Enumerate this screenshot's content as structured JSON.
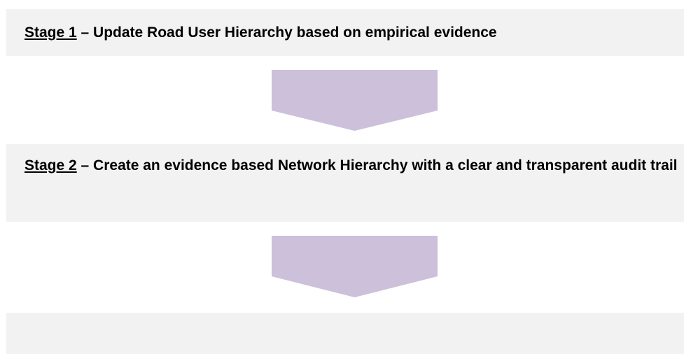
{
  "colors": {
    "box_fill": "#f2f2f2",
    "arrow_fill": "#ccc0da",
    "text": "#000000"
  },
  "stages": [
    {
      "tag": "Stage 1",
      "text": " – Update Road User Hierarchy based on empirical evidence"
    },
    {
      "tag": "Stage 2",
      "text": " – Create an evidence based Network Hierarchy with a clear and transparent audit trail"
    },
    {
      "tag": "",
      "text": ""
    }
  ],
  "connectors": [
    {
      "shape": "down-arrow-pentagon"
    },
    {
      "shape": "down-arrow-pentagon"
    }
  ]
}
